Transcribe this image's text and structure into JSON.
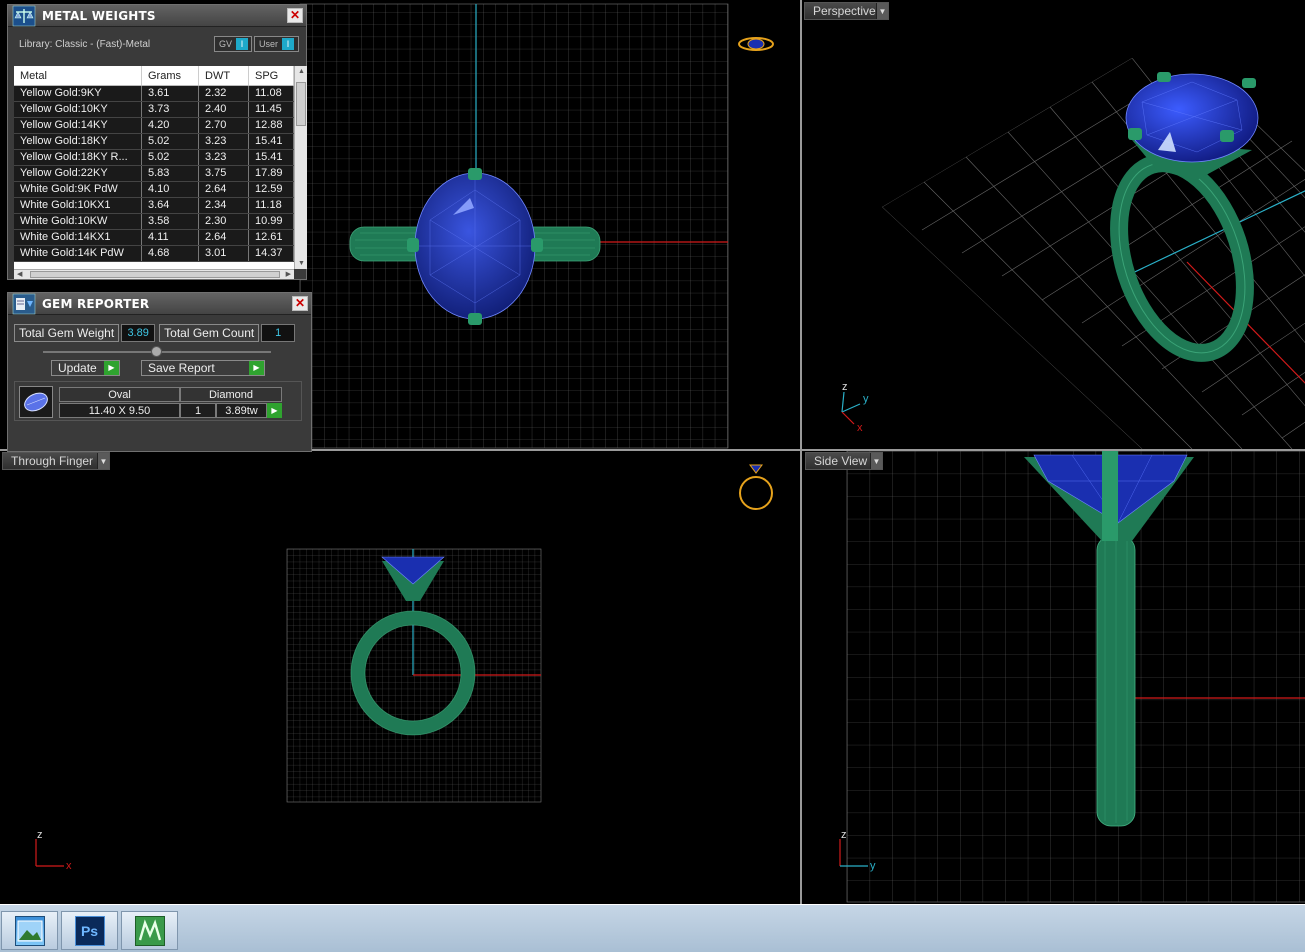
{
  "viewports": {
    "perspective": {
      "label": "Perspective"
    },
    "front": {
      "label": "Through Finger"
    },
    "side": {
      "label": "Side View"
    }
  },
  "axes": {
    "z": "z",
    "y": "y",
    "x": "x"
  },
  "metal_weights": {
    "title": "METAL WEIGHTS",
    "library": "Library: Classic - (Fast)-Metal",
    "toggle_gv": "GV",
    "toggle_user": "User",
    "columns": [
      "Metal",
      "Grams",
      "DWT",
      "SPG"
    ],
    "rows": [
      [
        "Yellow Gold:9KY",
        "3.61",
        "2.32",
        "11.08"
      ],
      [
        "Yellow Gold:10KY",
        "3.73",
        "2.40",
        "11.45"
      ],
      [
        "Yellow Gold:14KY",
        "4.20",
        "2.70",
        "12.88"
      ],
      [
        "Yellow Gold:18KY",
        "5.02",
        "3.23",
        "15.41"
      ],
      [
        "Yellow Gold:18KY R...",
        "5.02",
        "3.23",
        "15.41"
      ],
      [
        "Yellow Gold:22KY",
        "5.83",
        "3.75",
        "17.89"
      ],
      [
        "White Gold:9K PdW",
        "4.10",
        "2.64",
        "12.59"
      ],
      [
        "White Gold:10KX1",
        "3.64",
        "2.34",
        "11.18"
      ],
      [
        "White Gold:10KW",
        "3.58",
        "2.30",
        "10.99"
      ],
      [
        "White Gold:14KX1",
        "4.11",
        "2.64",
        "12.61"
      ],
      [
        "White Gold:14K PdW",
        "4.68",
        "3.01",
        "14.37"
      ]
    ]
  },
  "gem_reporter": {
    "title": "GEM REPORTER",
    "total_weight_label": "Total Gem Weight",
    "total_weight": "3.89",
    "total_count_label": "Total Gem Count",
    "total_count": "1",
    "update_label": "Update",
    "save_label": "Save Report",
    "gem": {
      "shape": "Oval",
      "material": "Diamond",
      "size": "11.40 X 9.50",
      "count": "1",
      "weight": "3.89tw"
    }
  },
  "colors": {
    "metal": "#1f7a55",
    "gem": "#1a2fb0",
    "grid": "#6a6a6a",
    "x_axis": "#d21a1a",
    "y_axis": "#2ab0c8"
  },
  "icons": [
    "scale-icon",
    "gem-reporter-icon",
    "close-icon",
    "play-arrow-icon",
    "photo-viewer-icon",
    "photoshop-icon",
    "matrix-icon"
  ],
  "taskbar": {
    "photoshop_label": "Ps"
  }
}
